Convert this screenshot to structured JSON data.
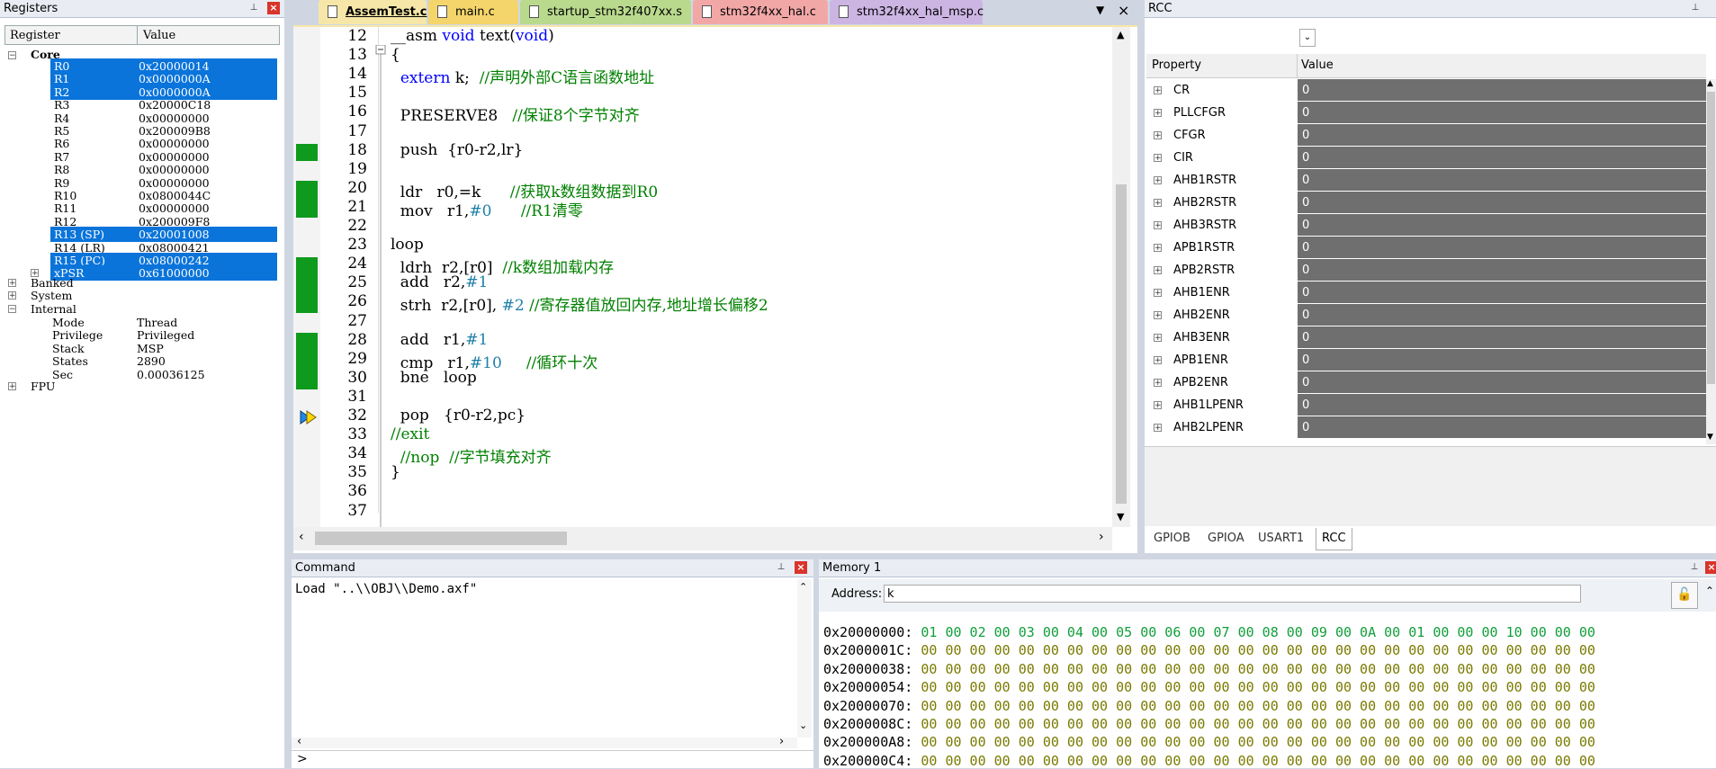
{
  "registers_panel": {
    "title": "Registers",
    "col_register": "Register",
    "col_value": "Value",
    "groups": {
      "core": "Core",
      "banked": "Banked",
      "system": "System",
      "internal": "Internal",
      "fpu": "FPU"
    },
    "core_rows": [
      {
        "name": "R0",
        "value": "0x20000014",
        "sel": true
      },
      {
        "name": "R1",
        "value": "0x0000000A",
        "sel": true
      },
      {
        "name": "R2",
        "value": "0x0000000A",
        "sel": true
      },
      {
        "name": "R3",
        "value": "0x20000C18",
        "sel": false
      },
      {
        "name": "R4",
        "value": "0x00000000",
        "sel": false
      },
      {
        "name": "R5",
        "value": "0x200009B8",
        "sel": false
      },
      {
        "name": "R6",
        "value": "0x00000000",
        "sel": false
      },
      {
        "name": "R7",
        "value": "0x00000000",
        "sel": false
      },
      {
        "name": "R8",
        "value": "0x00000000",
        "sel": false
      },
      {
        "name": "R9",
        "value": "0x00000000",
        "sel": false
      },
      {
        "name": "R10",
        "value": "0x0800044C",
        "sel": false
      },
      {
        "name": "R11",
        "value": "0x00000000",
        "sel": false
      },
      {
        "name": "R12",
        "value": "0x200009F8",
        "sel": false
      },
      {
        "name": "R13 (SP)",
        "value": "0x20001008",
        "sel": true
      },
      {
        "name": "R14 (LR)",
        "value": "0x08000421",
        "sel": false
      },
      {
        "name": "R15 (PC)",
        "value": "0x08000242",
        "sel": true
      },
      {
        "name": "xPSR",
        "value": "0x61000000",
        "sel": true
      }
    ],
    "internal_rows": [
      {
        "name": "Mode",
        "value": "Thread"
      },
      {
        "name": "Privilege",
        "value": "Privileged"
      },
      {
        "name": "Stack",
        "value": "MSP"
      },
      {
        "name": "States",
        "value": "2890"
      },
      {
        "name": "Sec",
        "value": "0.00036125"
      }
    ]
  },
  "editor": {
    "tabs": [
      {
        "label": "AssemTest.c",
        "color": "#f6e7a8",
        "active": true
      },
      {
        "label": "main.c",
        "color": "#f4d56b",
        "active": false
      },
      {
        "label": "startup_stm32f407xx.s",
        "color": "#b9d98d",
        "active": false
      },
      {
        "label": "stm32f4xx_hal.c",
        "color": "#f2a7a7",
        "active": false
      },
      {
        "label": "stm32f4xx_hal_msp.c",
        "color": "#cdb5e3",
        "active": false
      }
    ],
    "lines": [
      {
        "no": "12",
        "code": "<span>__asm </span><span class=\"kw\">void</span><span> text(</span><span class=\"kw\">void</span><span>)</span>"
      },
      {
        "no": "13",
        "code": "<span>{</span>"
      },
      {
        "no": "14",
        "code": "<span>  </span><span class=\"kw\">extern</span><span> k;  </span><span class=\"cm\">//声明外部C语言函数地址</span>"
      },
      {
        "no": "15",
        "code": ""
      },
      {
        "no": "16",
        "code": "<span>  PRESERVE8   </span><span class=\"cm\">//保证8个字节对齐</span>"
      },
      {
        "no": "17",
        "code": ""
      },
      {
        "no": "18",
        "code": "<span>  push  {r0-r2,lr}</span>"
      },
      {
        "no": "19",
        "code": ""
      },
      {
        "no": "20",
        "code": "<span>  ldr   r0,=k      </span><span class=\"cm\">//获取k数组数据到R0</span>"
      },
      {
        "no": "21",
        "code": "<span>  mov   r1,</span><span class=\"num\">#0</span><span>      </span><span class=\"cm\">//R1清零</span>"
      },
      {
        "no": "22",
        "code": ""
      },
      {
        "no": "23",
        "code": "<span>loop</span>"
      },
      {
        "no": "24",
        "code": "<span>  ldrh  r2,[r0]  </span><span class=\"cm\">//k数组加载内存</span>"
      },
      {
        "no": "25",
        "code": "<span>  add   r2,</span><span class=\"num\">#1</span>"
      },
      {
        "no": "26",
        "code": "<span>  strh  r2,[r0], </span><span class=\"num\">#2</span><span> </span><span class=\"cm\">//寄存器值放回内存,地址增长偏移2</span>"
      },
      {
        "no": "27",
        "code": ""
      },
      {
        "no": "28",
        "code": "<span>  add   r1,</span><span class=\"num\">#1</span>"
      },
      {
        "no": "29",
        "code": "<span>  cmp   r1,</span><span class=\"num\">#10</span><span>     </span><span class=\"cm\">//循环十次</span>"
      },
      {
        "no": "30",
        "code": "<span>  bne   loop</span>"
      },
      {
        "no": "31",
        "code": ""
      },
      {
        "no": "32",
        "code": "<span>  pop   {r0-r2,pc}</span>"
      },
      {
        "no": "33",
        "code": "<span class=\"cm\">//exit</span>"
      },
      {
        "no": "34",
        "code": "<span>  </span><span class=\"cm\">//nop  //字节填充对齐</span>"
      },
      {
        "no": "35",
        "code": "<span>}</span>"
      },
      {
        "no": "36",
        "code": ""
      },
      {
        "no": "37",
        "code": ""
      }
    ]
  },
  "rcc_panel": {
    "title": "RCC",
    "col_property": "Property",
    "col_value": "Value",
    "rows": [
      {
        "name": "CR",
        "value": "0"
      },
      {
        "name": "PLLCFGR",
        "value": "0"
      },
      {
        "name": "CFGR",
        "value": "0"
      },
      {
        "name": "CIR",
        "value": "0"
      },
      {
        "name": "AHB1RSTR",
        "value": "0"
      },
      {
        "name": "AHB2RSTR",
        "value": "0"
      },
      {
        "name": "AHB3RSTR",
        "value": "0"
      },
      {
        "name": "APB1RSTR",
        "value": "0"
      },
      {
        "name": "APB2RSTR",
        "value": "0"
      },
      {
        "name": "AHB1ENR",
        "value": "0"
      },
      {
        "name": "AHB2ENR",
        "value": "0"
      },
      {
        "name": "AHB3ENR",
        "value": "0"
      },
      {
        "name": "APB1ENR",
        "value": "0"
      },
      {
        "name": "APB2ENR",
        "value": "0"
      },
      {
        "name": "AHB1LPENR",
        "value": "0"
      },
      {
        "name": "AHB2LPENR",
        "value": "0"
      }
    ],
    "bottom_tabs": [
      "GPIOB",
      "GPIOA",
      "USART1",
      "RCC"
    ]
  },
  "command_panel": {
    "title": "Command",
    "output": "Load \"..\\\\OBJ\\\\Demo.axf\"",
    "prompt": ">"
  },
  "memory_panel": {
    "title": "Memory 1",
    "address_label": "Address:",
    "address_value": "k",
    "rows": [
      {
        "addr": "0x20000000:",
        "bytes": "01 00 02 00 03 00 04 00 05 00 06 00 07 00 08 00 09 00 0A 00 01 00 00 00 10 00 00 00",
        "nz": true
      },
      {
        "addr": "0x2000001C:",
        "bytes": "00 00 00 00 00 00 00 00 00 00 00 00 00 00 00 00 00 00 00 00 00 00 00 00 00 00 00 00",
        "nz": false
      },
      {
        "addr": "0x20000038:",
        "bytes": "00 00 00 00 00 00 00 00 00 00 00 00 00 00 00 00 00 00 00 00 00 00 00 00 00 00 00 00",
        "nz": false
      },
      {
        "addr": "0x20000054:",
        "bytes": "00 00 00 00 00 00 00 00 00 00 00 00 00 00 00 00 00 00 00 00 00 00 00 00 00 00 00 00",
        "nz": false
      },
      {
        "addr": "0x20000070:",
        "bytes": "00 00 00 00 00 00 00 00 00 00 00 00 00 00 00 00 00 00 00 00 00 00 00 00 00 00 00 00",
        "nz": false
      },
      {
        "addr": "0x2000008C:",
        "bytes": "00 00 00 00 00 00 00 00 00 00 00 00 00 00 00 00 00 00 00 00 00 00 00 00 00 00 00 00",
        "nz": false
      },
      {
        "addr": "0x200000A8:",
        "bytes": "00 00 00 00 00 00 00 00 00 00 00 00 00 00 00 00 00 00 00 00 00 00 00 00 00 00 00 00",
        "nz": false
      },
      {
        "addr": "0x200000C4:",
        "bytes": "00 00 00 00 00 00 00 00 00 00 00 00 00 00 00 00 00 00 00 00 00 00 00 00 00 00 00 00",
        "nz": false
      }
    ]
  }
}
